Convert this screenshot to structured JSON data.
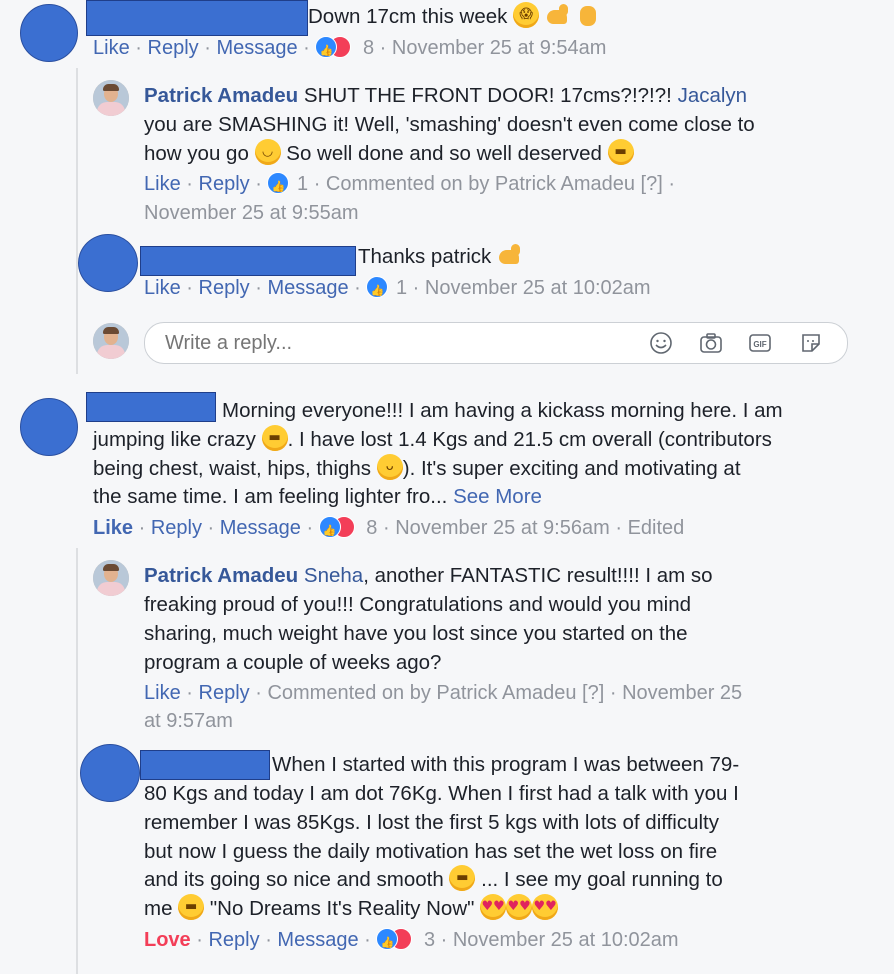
{
  "comments": [
    {
      "text": "Down 17cm this week",
      "actions": {
        "like": "Like",
        "reply": "Reply",
        "message": "Message"
      },
      "reaction_count": "8",
      "timestamp": "November 25 at 9:54am"
    },
    {
      "author": "Patrick Amadeu",
      "line1": "SHUT THE FRONT DOOR! 17cms?!?!?!",
      "tag": "Jacalyn",
      "line2": "you are SMASHING it! Well, 'smashing' doesn't even come close to",
      "line3a": "how you go",
      "line3b": "So well done and so well deserved",
      "actions": {
        "like": "Like",
        "reply": "Reply"
      },
      "reaction_count": "1",
      "commented_on": "Commented on by Patrick Amadeu",
      "help": "[?]",
      "timestamp": "November 25 at 9:55am"
    },
    {
      "text": "Thanks patrick",
      "actions": {
        "like": "Like",
        "reply": "Reply",
        "message": "Message"
      },
      "reaction_count": "1",
      "timestamp": "November 25 at 10:02am"
    },
    {
      "line1": "Morning everyone!!! I am having a kickass morning here. I am",
      "line2a": "jumping like crazy",
      "line2b": ". I have lost 1.4 Kgs and 21.5 cm overall (contributors",
      "line3a": "being chest, waist, hips, thighs",
      "line3b": "). It's super exciting and motivating at",
      "line4": "the same time. I am feeling lighter fro...",
      "see_more": "See More",
      "actions": {
        "like": "Like",
        "reply": "Reply",
        "message": "Message"
      },
      "reaction_count": "8",
      "timestamp": "November 25 at 9:56am",
      "edited": "Edited"
    },
    {
      "author": "Patrick Amadeu",
      "tag": "Sneha",
      "line1": ", another FANTASTIC result!!!! I am so",
      "line2": "freaking proud of you!!! Congratulations and would you mind",
      "line3": "sharing, much weight have you lost since you started on the",
      "line4": "program a couple of weeks ago?",
      "actions": {
        "like": "Like",
        "reply": "Reply"
      },
      "commented_on": "Commented on by Patrick Amadeu",
      "help": "[?]",
      "timestamp_a": "November 25",
      "timestamp_b": "at 9:57am"
    },
    {
      "line1": "When I started with this program I was between 79-",
      "line2": "80 Kgs and today I am dot 76Kg. When I first had a talk with you I",
      "line3": "remember I was 85Kgs. I lost the first 5 kgs with lots of difficulty",
      "line4": "but now I guess the daily motivation has set the wet loss on fire",
      "line5a": "and its going so nice and smooth",
      "line5b": "... I see my goal running to",
      "line6a": "me",
      "line6b": "\"No Dreams It's Reality Now\"",
      "actions": {
        "love": "Love",
        "reply": "Reply",
        "message": "Message"
      },
      "reaction_count": "3",
      "timestamp": "November 25 at 10:02am"
    }
  ],
  "reply_box": {
    "placeholder": "Write a reply..."
  },
  "separator": "·",
  "colors": {
    "link": "#4267b2",
    "meta": "#90949c",
    "love": "#f33e58",
    "name": "#365899"
  }
}
